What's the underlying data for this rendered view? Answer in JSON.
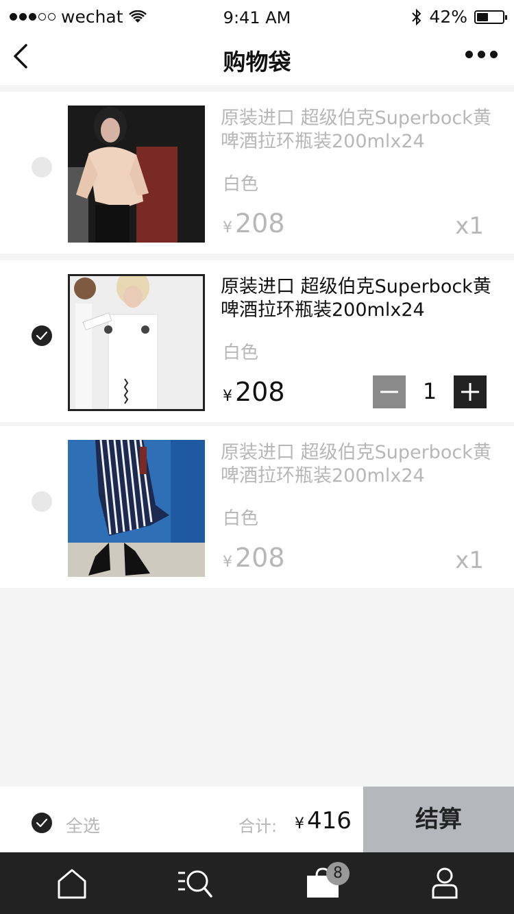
{
  "status": {
    "carrier": "wechat",
    "time": "9:41 AM",
    "battery": "42%",
    "signal_bars_filled": 3,
    "battery_level": 0.42
  },
  "nav": {
    "title": "购物袋",
    "back_icon": "chevron-left-icon",
    "more_icon": "more-dots-icon"
  },
  "items": [
    {
      "selected": false,
      "title": "原装进口 超级伯克Superbock黄啤酒拉环瓶装200mlx24",
      "color": "白色",
      "currency": "¥",
      "price": "208",
      "qty": "x1"
    },
    {
      "selected": true,
      "title": "原装进口 超级伯克Superbock黄啤酒拉环瓶装200mlx24",
      "color": "白色",
      "currency": "¥",
      "price": "208",
      "qty_value": "1"
    },
    {
      "selected": false,
      "title": "原装进口 超级伯克Superbock黄啤酒拉环瓶装200mlx24",
      "color": "白色",
      "currency": "¥",
      "price": "208",
      "qty": "x1"
    }
  ],
  "checkout": {
    "select_all": "全选",
    "total_label": "合计:",
    "currency": "¥",
    "total": "416",
    "button": "结算"
  },
  "tabbar": {
    "tabs": [
      "home-icon",
      "search-list-icon",
      "shopping-bag-icon",
      "profile-icon"
    ],
    "bag_badge": "8"
  },
  "colors": {
    "accent": "#222222",
    "muted_text": "#b7b7b7",
    "checkout_button": "#b5b7bd",
    "background": "#f4f4f4"
  }
}
